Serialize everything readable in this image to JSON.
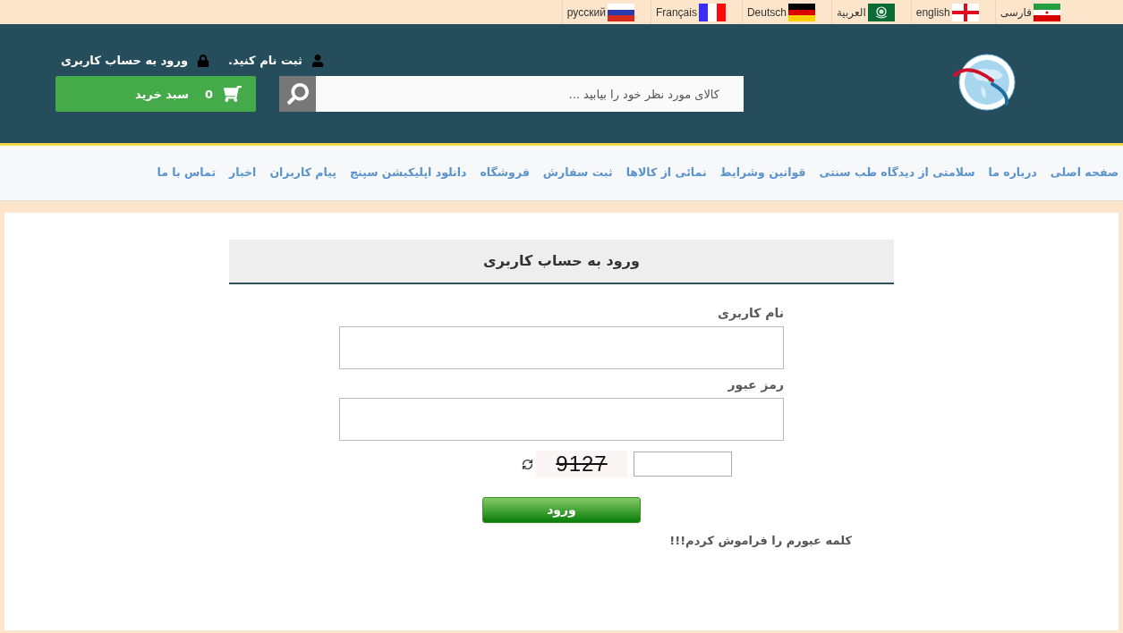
{
  "languages": [
    {
      "label": "فارسی",
      "kind": "iran"
    },
    {
      "label": "english",
      "kind": "england"
    },
    {
      "label": "العربية",
      "kind": "arableague"
    },
    {
      "label": "Deutsch",
      "kind": "germany"
    },
    {
      "label": "Français",
      "kind": "france"
    },
    {
      "label": "русский",
      "kind": "russia"
    }
  ],
  "header": {
    "account_links": [
      {
        "kind": "register",
        "label": "ثبت نام کنید."
      },
      {
        "kind": "login",
        "label": "ورود به حساب کاربری"
      }
    ],
    "search": {
      "placeholder": "کالای مورد نظر خود را بیابید ..."
    },
    "cart": {
      "count": "0",
      "label": "سبد خرید"
    }
  },
  "nav": {
    "items": [
      "صفحه اصلی",
      "درباره ما",
      "سلامتی از دیدگاه طب سنتی",
      "قوانین وشرایط",
      "نمائی از کالاها",
      "ثبت سفارش",
      "فروشگاه",
      "دانلود اپلیکیشن سپنج",
      "پیام کاربران",
      "اخبار",
      "تماس با ما"
    ]
  },
  "login": {
    "title": "ورود به حساب کاربری",
    "fields": [
      {
        "label": "نام کاربری"
      },
      {
        "label": "رمز عبور"
      }
    ],
    "captcha": {
      "code": "9127"
    },
    "submit": "ورود",
    "forgot_link": "کلمه عبورم را فراموش کردم!!!"
  }
}
